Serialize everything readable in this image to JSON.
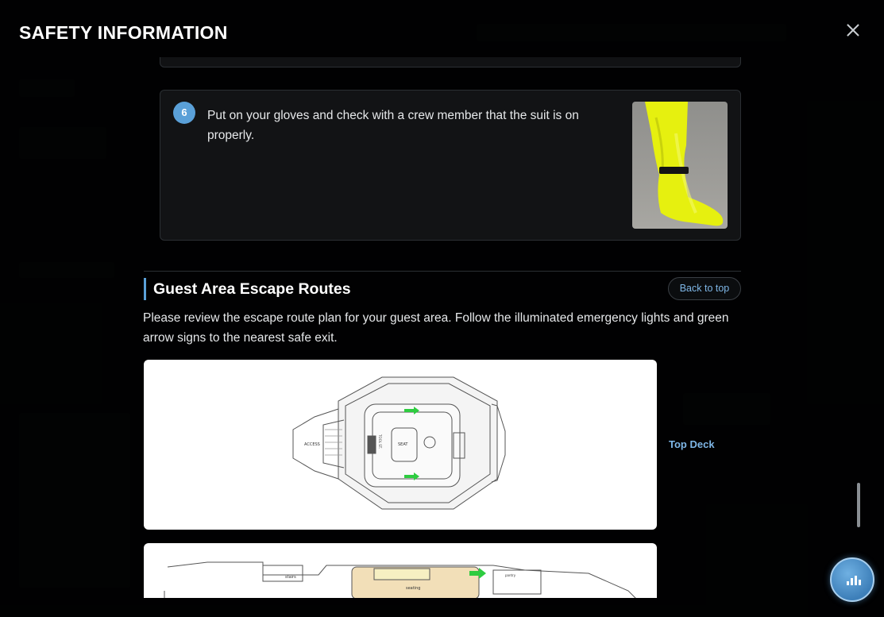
{
  "modal": {
    "title": "SAFETY INFORMATION"
  },
  "step": {
    "number": "6",
    "text": "Put on your gloves and check with a crew member that the suit is on properly."
  },
  "section": {
    "title": "Guest Area Escape Routes",
    "back_to_top": "Back to top",
    "description": "Please review the escape route plan for your guest area. Follow the illuminated emergency lights and green arrow signs to the nearest safe exit."
  },
  "plans": [
    {
      "label": "Top Deck",
      "labels": {
        "access": "ACCESS",
        "seat": "SEAT",
        "tool": "TOOL ST."
      }
    },
    {
      "labels": {
        "stairs": "stairs",
        "seating": "seating",
        "pantry": "pantry"
      }
    }
  ],
  "colors": {
    "accent": "#5aa0d8",
    "link": "#7eb6e6",
    "arrow_green": "#2ecc40",
    "suit_yellow": "#e6f00f"
  },
  "icons": {
    "close": "close-icon",
    "fab": "bar-chart-icon"
  }
}
